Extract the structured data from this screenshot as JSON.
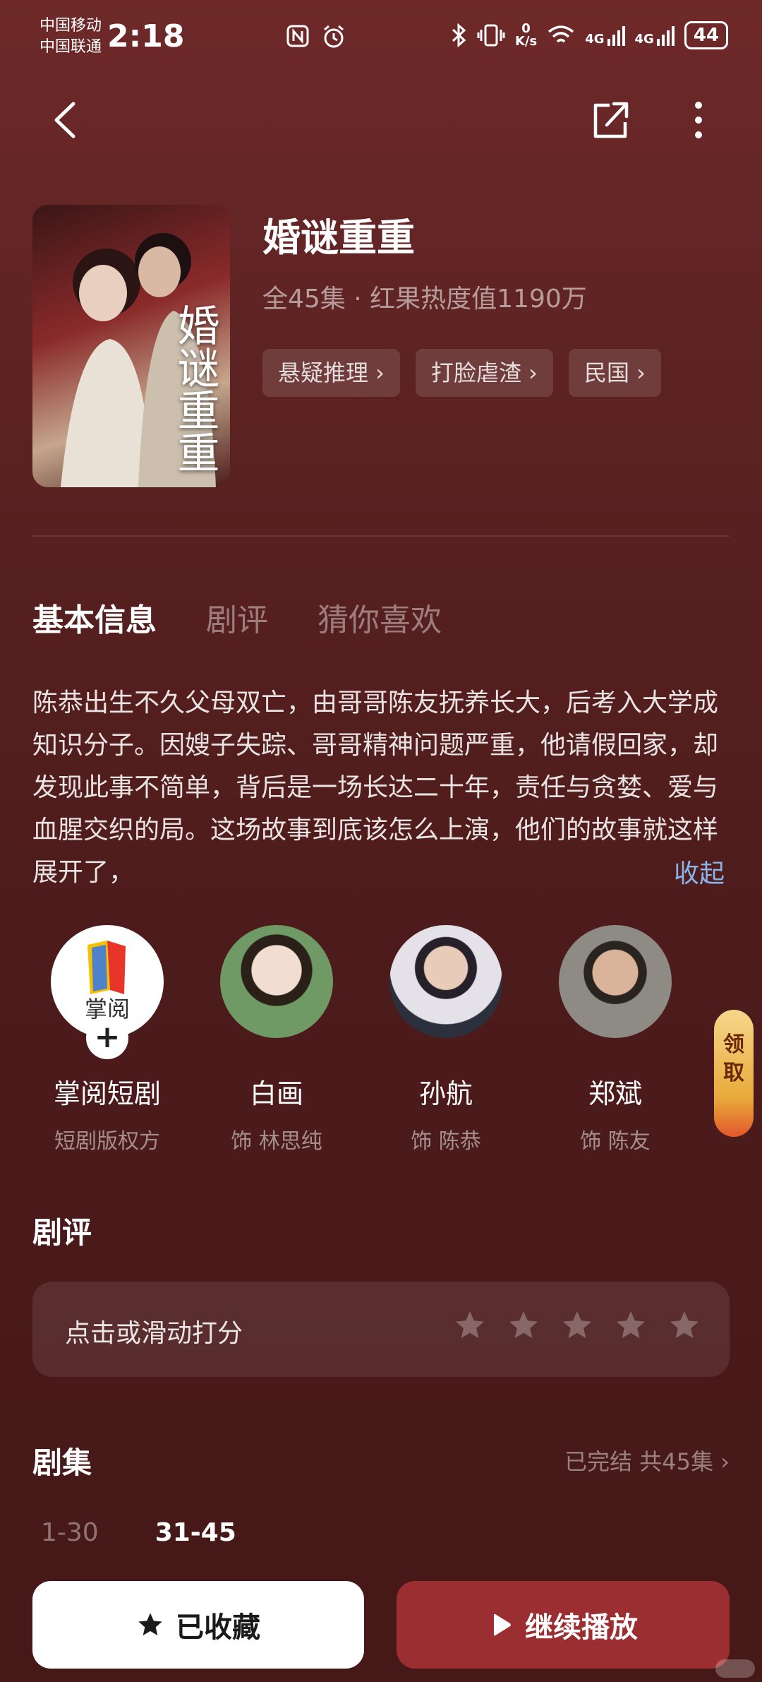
{
  "status_bar": {
    "carrier_1": "中国移动",
    "carrier_2": "中国联通",
    "time": "2:18",
    "net_speed_top": "0",
    "net_speed_bottom": "K/s",
    "signal_1": "4G",
    "signal_2": "4G",
    "battery": "44"
  },
  "drama": {
    "title": "婚谜重重",
    "meta": "全45集 · 红果热度值1190万",
    "poster_title": "婚谜重重",
    "tags": [
      "悬疑推理 ›",
      "打脸虐渣 ›",
      "民国 ›"
    ]
  },
  "tabs": [
    "基本信息",
    "剧评",
    "猜你喜欢"
  ],
  "synopsis": "陈恭出生不久父母双亡，由哥哥陈友抚养长大，后考入大学成知识分子。因嫂子失踪、哥哥精神问题严重，他请假回家，却发现此事不简单，背后是一场长达二十年，责任与贪婪、爱与血腥交织的局。这场故事到底该怎么上演，他们的故事就这样展开了，",
  "collapse_label": "收起",
  "cast": [
    {
      "name": "掌阅短剧",
      "role": "短剧版权方",
      "logo_text": "掌阅"
    },
    {
      "name": "白画",
      "role": "饰 林思纯"
    },
    {
      "name": "孙航",
      "role": "饰 陈恭"
    },
    {
      "name": "郑斌",
      "role": "饰 陈友"
    }
  ],
  "plus": "+",
  "floating_badge": "领取",
  "review": {
    "title": "剧评",
    "prompt": "点击或滑动打分",
    "stars": 5
  },
  "episodes": {
    "title": "剧集",
    "status": "已完结 共45集 ›",
    "ranges": [
      "1-30",
      "31-45"
    ]
  },
  "bottom": {
    "fav_label": "已收藏",
    "play_label": "继续播放"
  },
  "colors": {
    "accent": "#9b2e30",
    "link": "#8ab4e8",
    "background": "#5e2323"
  }
}
